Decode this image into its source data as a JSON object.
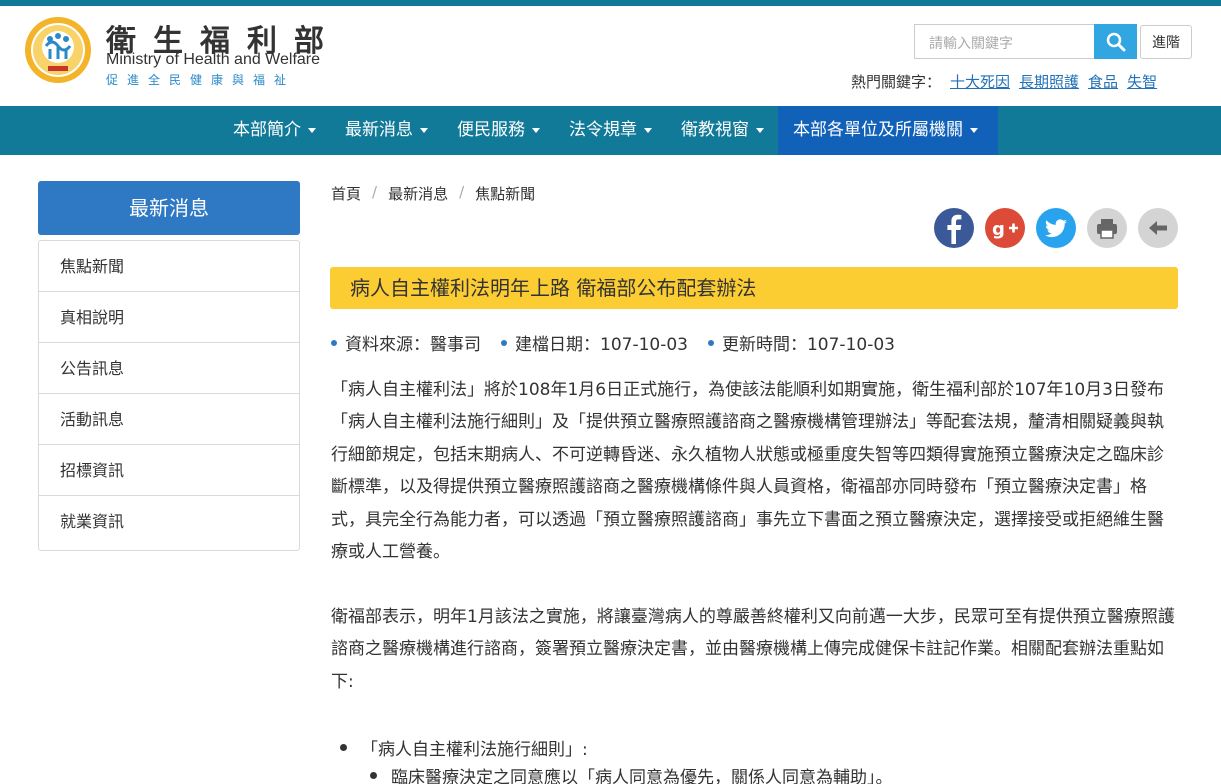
{
  "header": {
    "title": "衛生福利部",
    "title_en": "Ministry of Health and Welfare",
    "slogan": "促進全民健康與福祉",
    "search_placeholder": "請輸入關鍵字",
    "advanced_label": "進階",
    "hot_label": "熱門關鍵字：",
    "hot_keywords": [
      "十大死因",
      "長期照護",
      "食品",
      "失智"
    ]
  },
  "nav": {
    "items": [
      "本部簡介",
      "最新消息",
      "便民服務",
      "法令規章",
      "衛教視窗",
      "本部各單位及所屬機關"
    ]
  },
  "sidebar": {
    "heading": "最新消息",
    "items": [
      "焦點新聞",
      "真相說明",
      "公告訊息",
      "活動訊息",
      "招標資訊",
      "就業資訊"
    ]
  },
  "breadcrumb": [
    "首頁",
    "最新消息",
    "焦點新聞"
  ],
  "share_icons": [
    "facebook-icon",
    "google-plus-icon",
    "twitter-icon",
    "print-icon",
    "back-icon"
  ],
  "article": {
    "title": "病人自主權利法明年上路 衛福部公布配套辦法",
    "meta": [
      "資料來源：醫事司",
      "建檔日期：107-10-03",
      "更新時間：107-10-03"
    ],
    "paragraph1": "「病人自主權利法」將於108年1月6日正式施行，為使該法能順利如期實施，衛生福利部於107年10月3日發布「病人自主權利法施行細則」及「提供預立醫療照護諮商之醫療機構管理辦法」等配套法規，釐清相關疑義與執行細節規定，包括末期病人、不可逆轉昏迷、永久植物人狀態或極重度失智等四類得實施預立醫療決定之臨床診斷標準，以及得提供預立醫療照護諮商之醫療機構條件與人員資格，衛福部亦同時發布「預立醫療決定書」格式，具完全行為能力者，可以透過「預立醫療照護諮商」事先立下書面之預立醫療決定，選擇接受或拒絕維生醫療或人工營養。",
    "paragraph2": "衛福部表示，明年1月該法之實施，將讓臺灣病人的尊嚴善終權利又向前邁一大步，民眾可至有提供預立醫療照護諮商之醫療機構進行諮商，簽署預立醫療決定書，並由醫療機構上傳完成健保卡註記作業。相關配套辦法重點如下:",
    "bullet1": "「病人自主權利法施行細則」:",
    "bullet2": "臨床醫療決定之同意應以「病人同意為優先，關係人同意為輔助」。"
  },
  "colors": {
    "teal": "#127a99",
    "blue": "#2f79c4",
    "yellow": "#fccd33",
    "link": "#2272b8"
  }
}
